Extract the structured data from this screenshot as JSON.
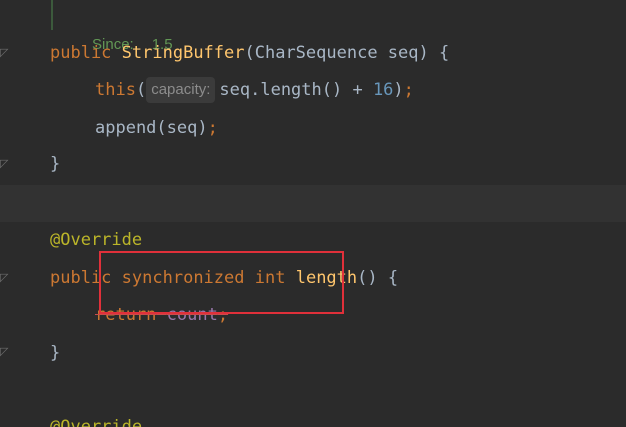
{
  "javadoc": {
    "since_label": "Since:",
    "since_value": "1.5"
  },
  "code": {
    "line1": {
      "kw_public": "public",
      "fn_name": "StringBuffer",
      "params": "(CharSequence seq) {"
    },
    "line2": {
      "kw_this": "this",
      "paren_open": "(",
      "hint_label": "capacity:",
      "expr": "seq.length() + ",
      "num": "16",
      "paren_close": ")",
      "semicolon": ";"
    },
    "line3": {
      "call": "append(seq)",
      "semicolon": ";"
    },
    "line4": {
      "brace": "}"
    },
    "line6": {
      "annotation": "@Override"
    },
    "line7": {
      "kw_public": "public",
      "kw_synchronized": "synchronized",
      "kw_int": "int",
      "fn_name": "length",
      "rest": "() {"
    },
    "line8": {
      "kw_return": "return",
      "field": "count",
      "semicolon": ";"
    },
    "line9": {
      "brace": "}"
    },
    "line11": {
      "annotation": "@Override"
    }
  },
  "colors": {
    "background": "#2b2b2b",
    "keyword": "#cc7832",
    "function": "#ffc66d",
    "number": "#6897bb",
    "annotation": "#bbb529",
    "field": "#9876aa",
    "doc": "#629755",
    "highlight_box": "#e0303a"
  }
}
